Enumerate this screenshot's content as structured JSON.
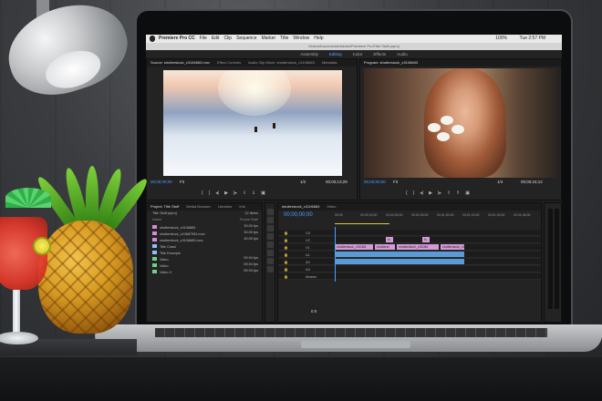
{
  "menubar": {
    "items": [
      "Premiere Pro CC",
      "File",
      "Edit",
      "Clip",
      "Sequence",
      "Marker",
      "Title",
      "Window",
      "Help"
    ],
    "clock": "Tue 2:57 PM",
    "battery": "100%"
  },
  "window": {
    "title": "/Users/Documents/Adobe/Premiere Pro/Title Stuff.prproj"
  },
  "workspaces": {
    "items": [
      "Assembly",
      "Editing",
      "Color",
      "Effects",
      "Audio"
    ],
    "active": "Editing"
  },
  "source_monitor": {
    "tabs": [
      "Source: shutterstock_v3106683.mov",
      "Effect Controls",
      "Audio Clip Mixer: shutterstock_v3106683",
      "Metadata"
    ],
    "timecode_in": "00;00;00;00",
    "fit": "Fit",
    "fraction": "1/2",
    "timecode_out": "00;00;13;29"
  },
  "program_monitor": {
    "tabs": [
      "Program: shutterstock_v3106683"
    ],
    "timecode_in": "00;00;00;00",
    "fit": "Fit",
    "fraction": "1/4",
    "timecode_out": "00;00;16;12"
  },
  "project_panel": {
    "tabs": [
      "Project: Title Stuff",
      "Media Browser",
      "Libraries",
      "Info"
    ],
    "project_name": "Title Stuff.prproj",
    "item_count": "12 Items",
    "columns": [
      "Name",
      "Frame Rate"
    ],
    "items": [
      {
        "name": "shutterstock_v3106683",
        "fps": "30.00 fps",
        "color": "#d68ad8"
      },
      {
        "name": "shutterstock_v10687932.mov",
        "fps": "30.00 fps",
        "color": "#d68ad8"
      },
      {
        "name": "shutterstock_v3106683.mov",
        "fps": "30.00 fps",
        "color": "#d68ad8"
      },
      {
        "name": "Title Crawl",
        "fps": "",
        "color": "#8bc0ff"
      },
      {
        "name": "Title Example",
        "fps": "",
        "color": "#8bc0ff"
      },
      {
        "name": "Video",
        "fps": "59.94 fps",
        "color": "#6fcf8a"
      },
      {
        "name": "Video",
        "fps": "59.94 fps",
        "color": "#6fcf8a"
      },
      {
        "name": "Video 3",
        "fps": "59.94 fps",
        "color": "#6fcf8a"
      }
    ]
  },
  "timeline": {
    "tabs": [
      "shutterstock_v3106683",
      "Video"
    ],
    "timecode": "00;00;00;00",
    "ruler": [
      "00;00",
      "00;00;15;00",
      "00;00;30;00",
      "00;00;45;00",
      "00;01;00;00",
      "00;01;15;00",
      "00;01;30;00",
      "00;01;45;00"
    ],
    "tracks": [
      "V3",
      "V2",
      "V1",
      "A1",
      "A2",
      "A3",
      "Master"
    ],
    "master_value": "0.0",
    "clips": {
      "v2a": "fx",
      "v2b": "fx",
      "v1": [
        "shutterstock_v31066",
        "shutterst",
        "shutterstock_v31066",
        "shutterstock_v3106683"
      ]
    }
  },
  "colors": {
    "accent": "#4aa0ff",
    "video_clip": "#d49ad6",
    "audio_clip": "#5b9bd5",
    "panel": "#232323"
  }
}
